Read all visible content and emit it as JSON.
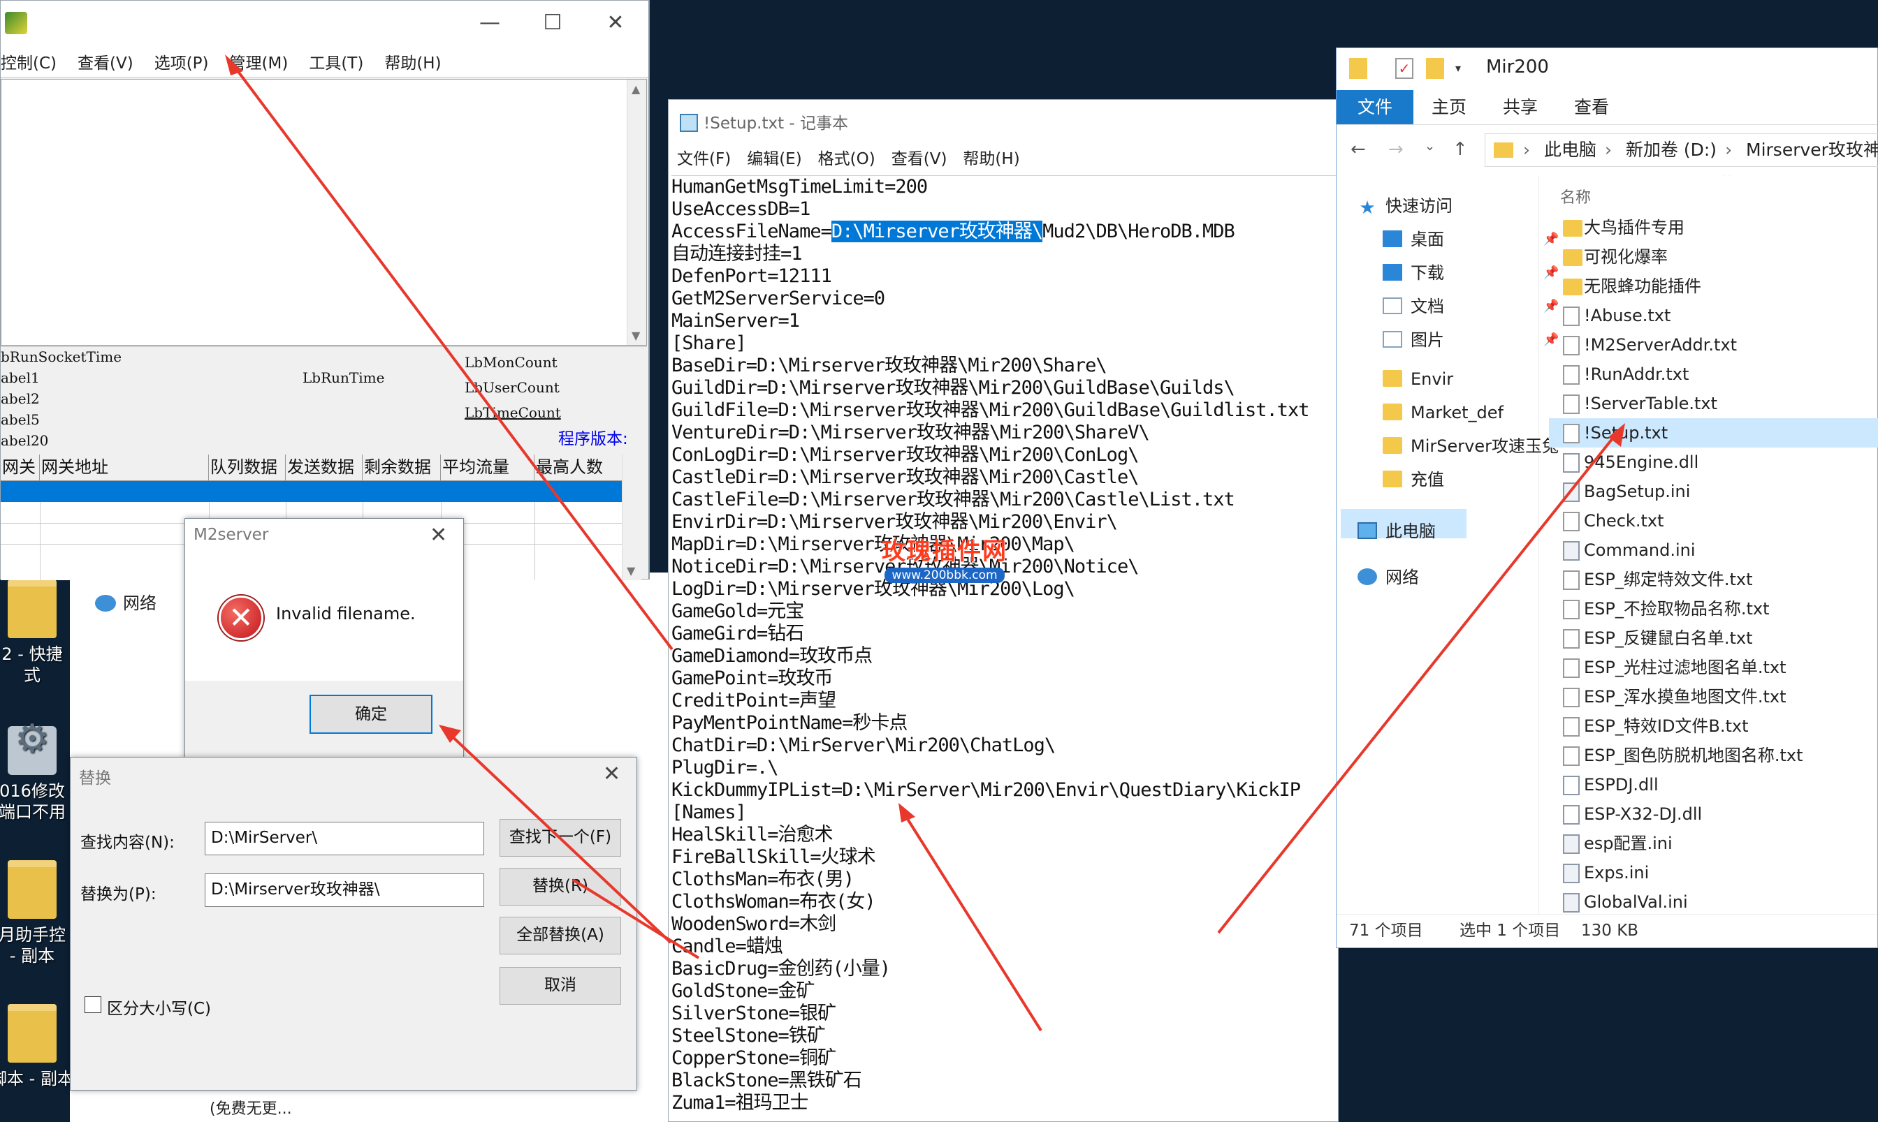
{
  "desktop": {
    "icons": [
      {
        "label": "2 - 快捷\n式"
      },
      {
        "label": "016修改\n端口不用"
      },
      {
        "label": "月助手控\n- 副本"
      },
      {
        "label": "脚本 - 副本"
      }
    ],
    "network_label": "网络",
    "bottom_text": "(免费无更..."
  },
  "m2server_window": {
    "menu": [
      "控制(C)",
      "查看(V)",
      "选项(P)",
      "管理(M)",
      "工具(T)",
      "帮助(H)"
    ],
    "labels": {
      "lb_run_socket_time": "bRunSocketTime",
      "label1": "abel1",
      "label2": "abel2",
      "label5": "abel5",
      "label20": "abel20",
      "lb_run_time": "LbRunTime",
      "lb_mon_count": "LbMonCount",
      "lb_user_count": "LbUserCount",
      "lb_time_count": "LbTimeCount",
      "version": "程序版本:"
    },
    "grid_columns": [
      "网关",
      "网关地址",
      "队列数据",
      "发送数据",
      "剩余数据",
      "平均流量",
      "最高人数"
    ]
  },
  "m2_error_dialog": {
    "title": "M2server",
    "message": "Invalid filename.",
    "ok_label": "确定"
  },
  "replace_dialog": {
    "title": "替换",
    "find_label": "查找内容(N):",
    "find_value": "D:\\MirServer\\",
    "replace_label": "替换为(P):",
    "replace_value": "D:\\Mirserver玫玫神器\\",
    "find_next": "查找下一个(F)",
    "replace": "替换(R)",
    "replace_all": "全部替换(A)",
    "cancel": "取消",
    "match_case": "区分大小写(C)"
  },
  "notepad": {
    "title": "!Setup.txt - 记事本",
    "menu": [
      "文件(F)",
      "编辑(E)",
      "格式(O)",
      "查看(V)",
      "帮助(H)"
    ],
    "lines": [
      "HumanGetMsgTimeLimit=200",
      "UseAccessDB=1",
      "AccessFileName=",
      "自动连接封挂=1",
      "DefenPort=12111",
      "GetM2ServerService=0",
      "MainServer=1",
      "[Share]",
      "BaseDir=D:\\Mirserver玫玫神器\\Mir200\\Share\\",
      "GuildDir=D:\\Mirserver玫玫神器\\Mir200\\GuildBase\\Guilds\\",
      "GuildFile=D:\\Mirserver玫玫神器\\Mir200\\GuildBase\\Guildlist.txt",
      "VentureDir=D:\\Mirserver玫玫神器\\Mir200\\ShareV\\",
      "ConLogDir=D:\\Mirserver玫玫神器\\Mir200\\ConLog\\",
      "CastleDir=D:\\Mirserver玫玫神器\\Mir200\\Castle\\",
      "CastleFile=D:\\Mirserver玫玫神器\\Mir200\\Castle\\List.txt",
      "EnvirDir=D:\\Mirserver玫玫神器\\Mir200\\Envir\\",
      "MapDir=D:\\Mirserver玫玫神器\\Mir200\\Map\\",
      "NoticeDir=D:\\Mirserver玫玫神器\\Mir200\\Notice\\",
      "LogDir=D:\\Mirserver玫玫神器\\Mir200\\Log\\",
      "GameGold=元宝",
      "GameGird=钻石",
      "GameDiamond=玫玫币点",
      "GamePoint=玫玫币",
      "CreditPoint=声望",
      "PayMentPointName=秒卡点",
      "ChatDir=D:\\MirServer\\Mir200\\ChatLog\\",
      "PlugDir=.\\",
      "KickDummyIPList=D:\\MirServer\\Mir200\\Envir\\QuestDiary\\KickIP",
      "[Names]",
      "HealSkill=治愈术",
      "FireBallSkill=火球术",
      "ClothsMan=布衣(男)",
      "ClothsWoman=布衣(女)",
      "WoodenSword=木剑",
      "Candle=蜡烛",
      "BasicDrug=金创药(小量)",
      "GoldStone=金矿",
      "SilverStone=银矿",
      "SteelStone=铁矿",
      "CopperStone=铜矿",
      "BlackStone=黑铁矿石",
      "Zuma1=祖玛卫士"
    ],
    "selected_text": "D:\\Mirserver玫玫神器\\",
    "after_selection": "Mud2\\DB\\HeroDB.MDB"
  },
  "explorer": {
    "title": "Mir200",
    "ribbon_tabs": [
      "文件",
      "主页",
      "共享",
      "查看"
    ],
    "breadcrumb": [
      "此电脑",
      "新加卷 (D:)",
      "Mirserver玫玫神器"
    ],
    "nav": [
      {
        "label": "快速访问",
        "icon": "star"
      },
      {
        "label": "桌面",
        "icon": "blue",
        "pin": true
      },
      {
        "label": "下载",
        "icon": "blue",
        "pin": true
      },
      {
        "label": "文档",
        "icon": "doc",
        "pin": true
      },
      {
        "label": "图片",
        "icon": "doc",
        "pin": true
      },
      {
        "label": "Envir",
        "icon": "fold"
      },
      {
        "label": "Market_def",
        "icon": "fold"
      },
      {
        "label": "MirServer攻速玉兔",
        "icon": "fold"
      },
      {
        "label": "充值",
        "icon": "fold"
      },
      {
        "label": "此电脑",
        "icon": "pc"
      },
      {
        "label": "网络",
        "icon": "net"
      }
    ],
    "column_name": "名称",
    "files": [
      {
        "name": "大鸟插件专用",
        "type": "fold"
      },
      {
        "name": "可视化爆率",
        "type": "fold"
      },
      {
        "name": "无限蜂功能插件",
        "type": "fold"
      },
      {
        "name": "!Abuse.txt",
        "type": "txt"
      },
      {
        "name": "!M2ServerAddr.txt",
        "type": "txt"
      },
      {
        "name": "!RunAddr.txt",
        "type": "txt"
      },
      {
        "name": "!ServerTable.txt",
        "type": "txt"
      },
      {
        "name": "!Setup.txt",
        "type": "txt",
        "selected": true
      },
      {
        "name": "945Engine.dll",
        "type": "dll"
      },
      {
        "name": "BagSetup.ini",
        "type": "ini"
      },
      {
        "name": "Check.txt",
        "type": "txt"
      },
      {
        "name": "Command.ini",
        "type": "ini"
      },
      {
        "name": "ESP_绑定特效文件.txt",
        "type": "txt"
      },
      {
        "name": "ESP_不捡取物品名称.txt",
        "type": "txt"
      },
      {
        "name": "ESP_反键鼠白名单.txt",
        "type": "txt"
      },
      {
        "name": "ESP_光柱过滤地图名单.txt",
        "type": "txt"
      },
      {
        "name": "ESP_浑水摸鱼地图文件.txt",
        "type": "txt"
      },
      {
        "name": "ESP_特效ID文件B.txt",
        "type": "txt"
      },
      {
        "name": "ESP_图色防脱机地图名称.txt",
        "type": "txt"
      },
      {
        "name": "ESPDJ.dll",
        "type": "dll"
      },
      {
        "name": "ESP-X32-DJ.dll",
        "type": "dll"
      },
      {
        "name": "esp配置.ini",
        "type": "ini"
      },
      {
        "name": "Exps.ini",
        "type": "ini"
      },
      {
        "name": "GlobalVal.ini",
        "type": "ini"
      }
    ],
    "status": {
      "count": "71 个项目",
      "selected": "选中 1 个项目",
      "size": "130 KB"
    }
  },
  "watermark": {
    "title": "玫瑰插件网",
    "url": "www.200bbk.com"
  },
  "colors": {
    "selection": "#0078d7",
    "ribbon_active": "#1979ca",
    "arrow": "#e8382c",
    "version_text": "#0000ee"
  }
}
